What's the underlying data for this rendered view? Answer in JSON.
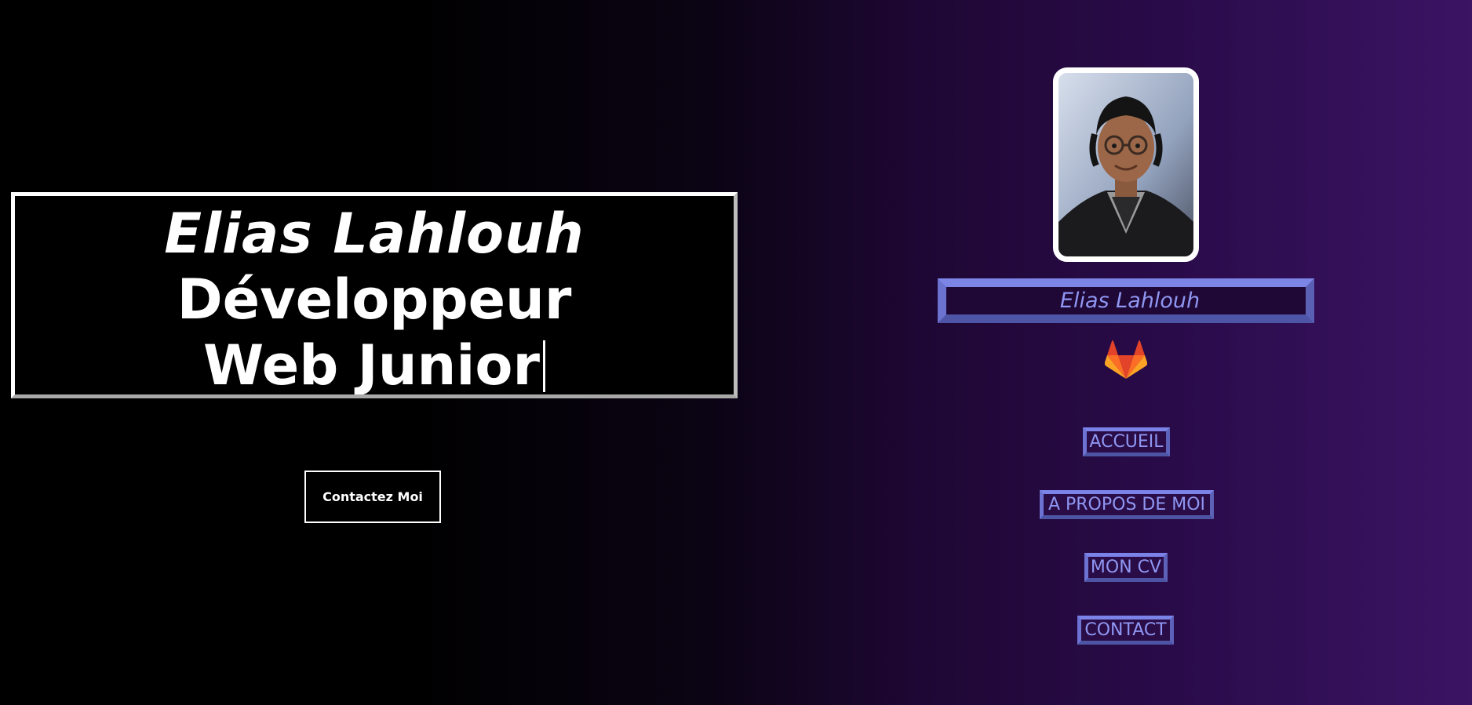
{
  "hero": {
    "name": "Elias Lahlouh",
    "role": "Développeur Web Junior"
  },
  "contact_button": {
    "label": "Contactez Moi"
  },
  "profile": {
    "name": "Elias Lahlouh",
    "avatar_icon": "profile-photo",
    "gitlab_icon": "gitlab-icon"
  },
  "nav": {
    "items": [
      {
        "label": "ACCUEIL"
      },
      {
        "label": "A PROPOS DE MOI"
      },
      {
        "label": "MON CV"
      },
      {
        "label": "CONTACT"
      }
    ]
  },
  "colors": {
    "accent": "#8f97f2",
    "border_accent": "#7c84e6",
    "background_dark": "#000000",
    "background_purple": "#3b1464"
  }
}
